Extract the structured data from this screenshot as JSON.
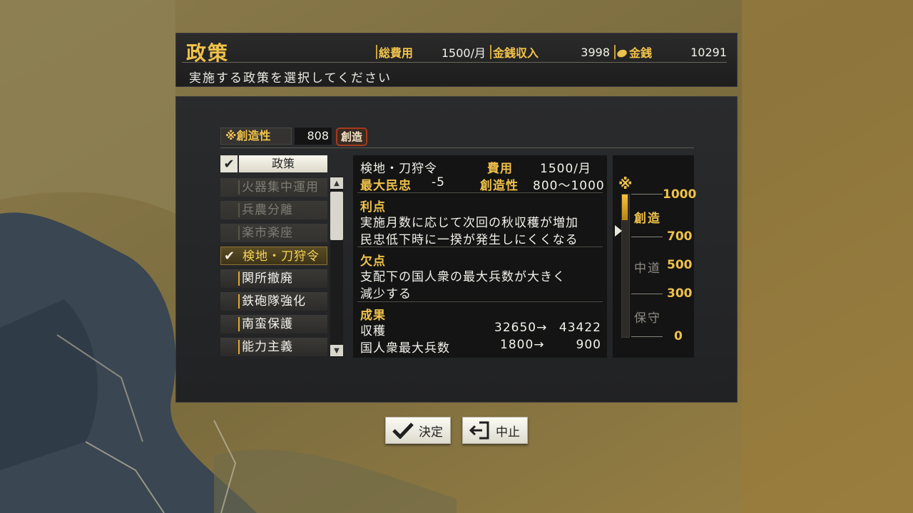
{
  "header": {
    "title": "政策",
    "subtitle": "実施する政策を選択してください",
    "total_cost_label": "総費用",
    "total_cost_value": "1500/月",
    "income_label": "金銭収入",
    "income_value": "3998",
    "money_label": "金銭",
    "money_value": "10291"
  },
  "creativity": {
    "label": "※創造性",
    "value": "808",
    "badge": "創造"
  },
  "policy_list": {
    "header_label": "政策",
    "items": [
      {
        "label": "火器集中運用",
        "state": "disabled"
      },
      {
        "label": "兵農分離",
        "state": "disabled"
      },
      {
        "label": "楽市楽座",
        "state": "disabled"
      },
      {
        "label": "検地・刀狩令",
        "state": "selected"
      },
      {
        "label": "関所撤廃",
        "state": "normal"
      },
      {
        "label": "鉄砲隊強化",
        "state": "normal"
      },
      {
        "label": "南蛮保護",
        "state": "normal"
      },
      {
        "label": "能力主義",
        "state": "normal"
      }
    ]
  },
  "detail": {
    "name": "検地・刀狩令",
    "cost_label": "費用",
    "cost_value": "1500/月",
    "max_loyalty_label": "最大民忠",
    "max_loyalty_value": "-5",
    "creativity_label": "創造性",
    "creativity_range": "800〜1000",
    "merit_label": "利点",
    "merit_lines": [
      "実施月数に応じて次回の秋収穫が増加",
      "民忠低下時に一揆が発生しにくくなる"
    ],
    "demerit_label": "欠点",
    "demerit_lines": [
      "支配下の国人衆の最大兵数が大きく",
      "減少する"
    ],
    "result_label": "成果",
    "results": [
      {
        "name": "収穫",
        "from": "32650→",
        "to": "43422"
      },
      {
        "name": "国人衆最大兵数",
        "from": "1800→",
        "to": "900"
      }
    ]
  },
  "gauge": {
    "icon": "※",
    "ticks": [
      "1000",
      "700",
      "500",
      "300",
      "0"
    ],
    "zones": [
      "創造",
      "中道",
      "保守"
    ],
    "fill_fraction": 0.18
  },
  "buttons": {
    "confirm_label": "決定",
    "cancel_label": "中止"
  },
  "colors": {
    "accent_gold": "#f0c24a",
    "panel_dark": "#141414",
    "badge_red": "#a43a1c"
  }
}
